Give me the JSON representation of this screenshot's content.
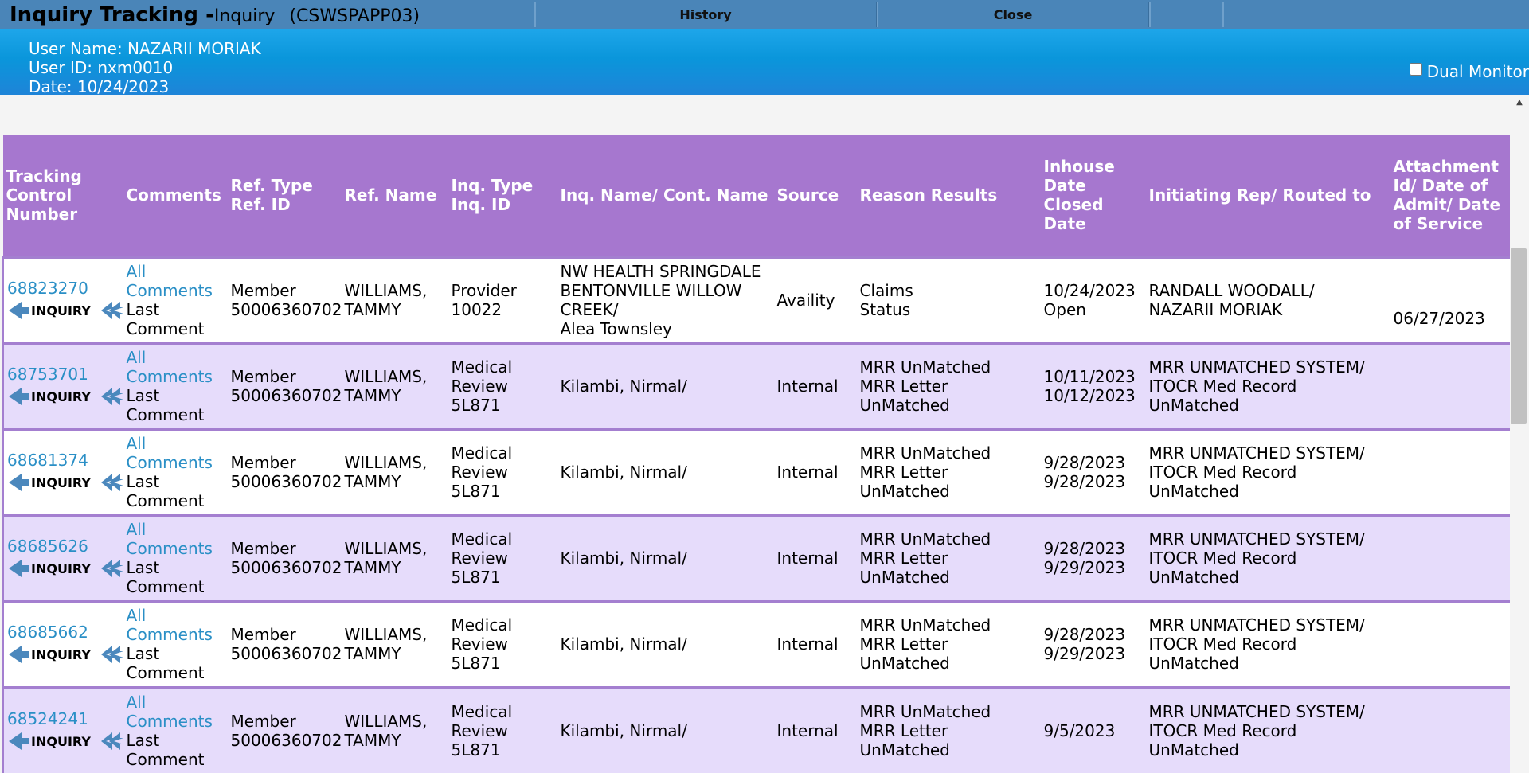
{
  "header": {
    "title_bold": "Inquiry Tracking -",
    "title_sub": "Inquiry",
    "server": "(CSWSPAPP03)",
    "menu": {
      "history": "History",
      "close": "Close"
    }
  },
  "user": {
    "name": "User Name: NAZARII MORIAK",
    "id": "User ID: nxm0010",
    "date": "Date: 10/24/2023",
    "dual_monitor": "Dual Monitor"
  },
  "colors": {
    "header_bg": "#a677cf",
    "row_odd": "#ffffff",
    "row_even": "#e6dcfb",
    "link": "#2a8fc6",
    "topbar": "#4a85b8",
    "userband": "#0a96db"
  },
  "table": {
    "columns": [
      "Tracking Control Number",
      "Comments",
      "Ref. Type Ref. ID",
      "Ref. Name",
      "Inq. Type Inq. ID",
      "Inq. Name/ Cont. Name",
      "Source",
      "Reason Results",
      "Inhouse Date Closed Date",
      "Initiating Rep/ Routed to",
      "Attachment Id/ Date of Admit/ Date of Service"
    ],
    "comments_link": "All Comments",
    "comments_last": "Last Comment",
    "badge_text": "INQUIRY",
    "rows": [
      {
        "tcn": "68823270",
        "ref_type": "Member",
        "ref_id": "50006360702",
        "ref_name": "WILLIAMS, TAMMY",
        "inq_type": "Provider",
        "inq_id": "10022",
        "inq_name": "NW HEALTH SPRINGDALE BENTONVILLE WILLOW CREEK/",
        "cont_name": "Alea Townsley",
        "source": "Availity",
        "reason": "Claims",
        "results": "Status",
        "inhouse": "10/24/2023",
        "closed": "Open",
        "rep": "RANDALL WOODALL/",
        "routed": "NAZARII MORIAK",
        "attach": "06/27/2023"
      },
      {
        "tcn": "68753701",
        "ref_type": "Member",
        "ref_id": "50006360702",
        "ref_name": "WILLIAMS, TAMMY",
        "inq_type": "Medical Review",
        "inq_id": "5L871",
        "inq_name": "Kilambi, Nirmal/",
        "cont_name": "",
        "source": "Internal",
        "reason": "MRR UnMatched",
        "results": "MRR Letter UnMatched",
        "inhouse": "10/11/2023",
        "closed": "10/12/2023",
        "rep": "MRR UNMATCHED SYSTEM/",
        "routed": "ITOCR Med Record UnMatched",
        "attach": ""
      },
      {
        "tcn": "68681374",
        "ref_type": "Member",
        "ref_id": "50006360702",
        "ref_name": "WILLIAMS, TAMMY",
        "inq_type": "Medical Review",
        "inq_id": "5L871",
        "inq_name": "Kilambi, Nirmal/",
        "cont_name": "",
        "source": "Internal",
        "reason": "MRR UnMatched",
        "results": "MRR Letter UnMatched",
        "inhouse": "9/28/2023",
        "closed": "9/28/2023",
        "rep": "MRR UNMATCHED SYSTEM/",
        "routed": "ITOCR Med Record UnMatched",
        "attach": ""
      },
      {
        "tcn": "68685626",
        "ref_type": "Member",
        "ref_id": "50006360702",
        "ref_name": "WILLIAMS, TAMMY",
        "inq_type": "Medical Review",
        "inq_id": "5L871",
        "inq_name": "Kilambi, Nirmal/",
        "cont_name": "",
        "source": "Internal",
        "reason": "MRR UnMatched",
        "results": "MRR Letter UnMatched",
        "inhouse": "9/28/2023",
        "closed": "9/29/2023",
        "rep": "MRR UNMATCHED SYSTEM/",
        "routed": "ITOCR Med Record UnMatched",
        "attach": ""
      },
      {
        "tcn": "68685662",
        "ref_type": "Member",
        "ref_id": "50006360702",
        "ref_name": "WILLIAMS, TAMMY",
        "inq_type": "Medical Review",
        "inq_id": "5L871",
        "inq_name": "Kilambi, Nirmal/",
        "cont_name": "",
        "source": "Internal",
        "reason": "MRR UnMatched",
        "results": "MRR Letter UnMatched",
        "inhouse": "9/28/2023",
        "closed": "9/29/2023",
        "rep": "MRR UNMATCHED SYSTEM/",
        "routed": "ITOCR Med Record UnMatched",
        "attach": ""
      },
      {
        "tcn": "68524241",
        "ref_type": "Member",
        "ref_id": "50006360702",
        "ref_name": "WILLIAMS, TAMMY",
        "inq_type": "Medical Review",
        "inq_id": "5L871",
        "inq_name": "Kilambi, Nirmal/",
        "cont_name": "",
        "source": "Internal",
        "reason": "MRR UnMatched",
        "results": "MRR Letter UnMatched",
        "inhouse": "9/5/2023",
        "closed": "",
        "rep": "MRR UNMATCHED SYSTEM/",
        "routed": "ITOCR Med Record UnMatched",
        "attach": ""
      }
    ]
  }
}
